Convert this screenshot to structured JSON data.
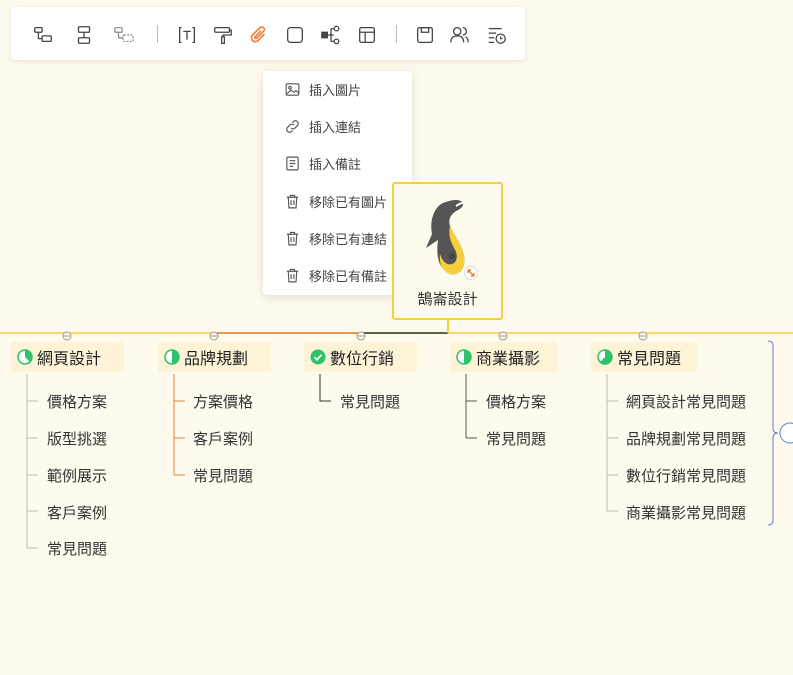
{
  "toolbar": {
    "icons": [
      "add-child-topic-icon",
      "add-sibling-topic-icon",
      "add-floating-topic-icon",
      "text-icon",
      "format-painter-icon",
      "attachment-icon",
      "shape-icon",
      "structure-icon",
      "layout-icon",
      "save-icon",
      "collaborators-icon",
      "task-schedule-icon"
    ]
  },
  "insert_menu": {
    "items": [
      {
        "label": "插入圖片",
        "icon": "image-icon"
      },
      {
        "label": "插入連結",
        "icon": "link-icon"
      },
      {
        "label": "插入備註",
        "icon": "note-icon"
      },
      {
        "label": "移除已有圖片",
        "icon": "trash-icon"
      },
      {
        "label": "移除已有連結",
        "icon": "trash-icon"
      },
      {
        "label": "移除已有備註",
        "icon": "trash-icon"
      }
    ]
  },
  "root": {
    "label": "鵠崙設計",
    "logo": "pelican-logo"
  },
  "categories": [
    {
      "label": "網頁設計",
      "progress": 0.375,
      "children": [
        "價格方案",
        "版型挑選",
        "範例展示",
        "客戶案例",
        "常見問題"
      ]
    },
    {
      "label": "品牌規劃",
      "progress": 0.5,
      "children": [
        "方案價格",
        "客戶案例",
        "常見問題"
      ]
    },
    {
      "label": "數位行銷",
      "progress": 1,
      "children": [
        "常見問題"
      ]
    },
    {
      "label": "商業攝影",
      "progress": 0.5,
      "children": [
        "價格方案",
        "常見問題"
      ]
    },
    {
      "label": "常見問題",
      "progress": 0.625,
      "children": [
        "網頁設計常見問題",
        "品牌規劃常見問題",
        "數位行銷常見問題",
        "商業攝影常見問題"
      ]
    }
  ],
  "colors": {
    "background": "#fefaed",
    "accent": "#f5cf3c",
    "progress": "#2dc26b",
    "link_orange": "#e8803a",
    "summary_blue": "#5b7fd8"
  }
}
